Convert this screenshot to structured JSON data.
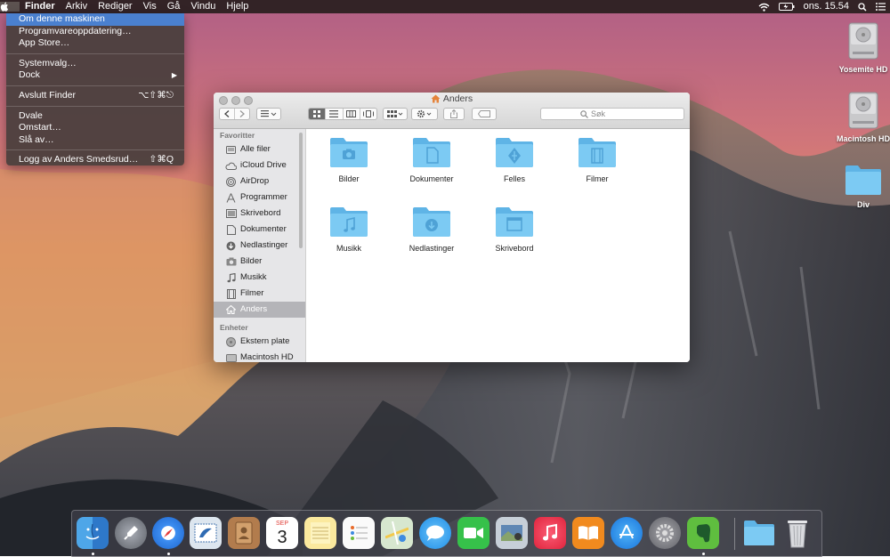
{
  "menubar": {
    "apple": "",
    "items": [
      "Finder",
      "Arkiv",
      "Rediger",
      "Vis",
      "Gå",
      "Vindu",
      "Hjelp"
    ],
    "clock": "ons. 15.54"
  },
  "apple_menu": {
    "about": "Om denne maskinen",
    "update": "Programvareoppdatering…",
    "appstore": "App Store…",
    "prefs": "Systemvalg…",
    "dock": "Dock",
    "force_quit": "Avslutt Finder",
    "force_quit_shortcut": "⌥⇧⌘⎋",
    "sleep": "Dvale",
    "restart": "Omstart…",
    "shutdown": "Slå av…",
    "logout": "Logg av Anders Smedsrud…",
    "logout_shortcut": "⇧⌘Q"
  },
  "desktop": {
    "icons": [
      "Yosemite HD",
      "Macintosh HD",
      "Div"
    ]
  },
  "window": {
    "title": "Anders",
    "search_placeholder": "Søk"
  },
  "sidebar": {
    "favorites_header": "Favoritter",
    "favorites": [
      "Alle filer",
      "iCloud Drive",
      "AirDrop",
      "Programmer",
      "Skrivebord",
      "Dokumenter",
      "Nedlastinger",
      "Bilder",
      "Musikk",
      "Filmer",
      "Anders"
    ],
    "devices_header": "Enheter",
    "devices": [
      "Ekstern plate",
      "Macintosh HD"
    ]
  },
  "folders": [
    "Bilder",
    "Dokumenter",
    "Felles",
    "Filmer",
    "Musikk",
    "Nedlastinger",
    "Skrivebord"
  ],
  "dock": {
    "calendar_month": "SEP",
    "calendar_day": "3"
  }
}
